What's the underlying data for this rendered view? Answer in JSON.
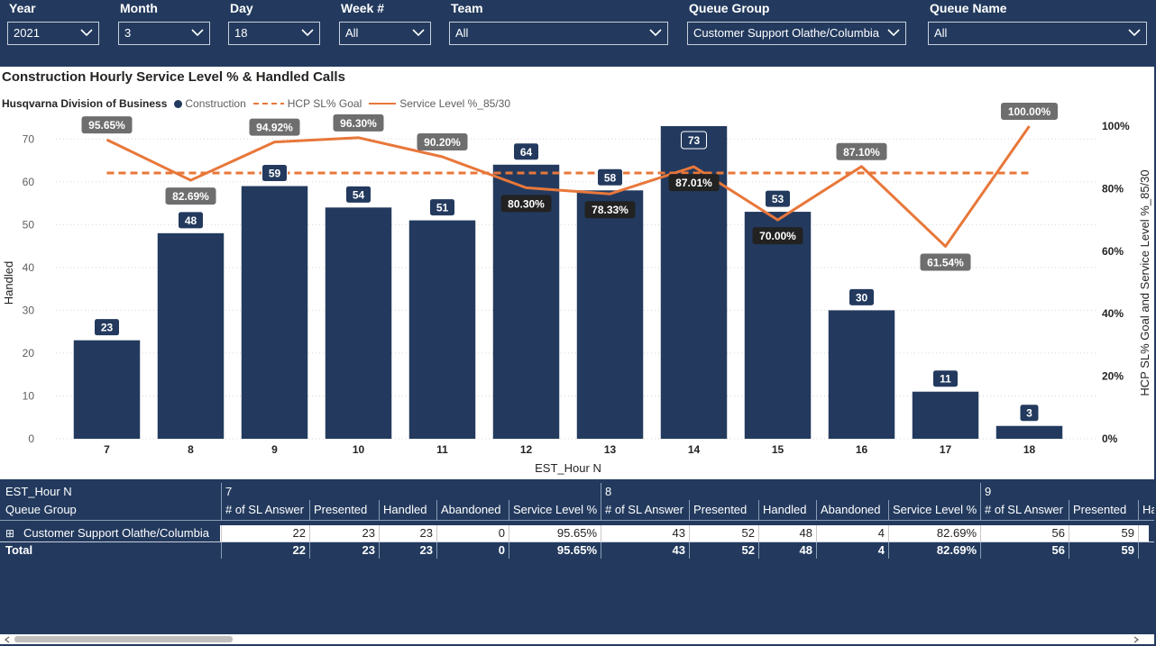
{
  "filters": [
    {
      "label": "Year",
      "value": "2021"
    },
    {
      "label": "Month",
      "value": "3"
    },
    {
      "label": "Day",
      "value": "18"
    },
    {
      "label": "Week #",
      "value": "All"
    },
    {
      "label": "Team",
      "value": "All"
    },
    {
      "label": "Queue Group",
      "value": "Customer Support Olathe/Columbia"
    },
    {
      "label": "Queue Name",
      "value": "All"
    }
  ],
  "colors": {
    "bar": "#233a5e",
    "line": "#e8773a",
    "goal": "#e8773a",
    "label_bg": "#233a5e",
    "pct_bg": "#6e6e6e",
    "pct_dark": "#222222"
  },
  "chart_data": {
    "type": "bar",
    "title": "Construction Hourly Service Level % & Handled Calls",
    "legend_title": "Husqvarna Division of Business",
    "xlabel": "EST_Hour N",
    "ylabel": "Handled",
    "y2label": "HCP SL% Goal and Service Level %_85/30",
    "ylim": [
      0,
      73
    ],
    "y2lim": [
      0,
      100
    ],
    "yticks": [
      "0",
      "10",
      "20",
      "30",
      "40",
      "50",
      "60",
      "70"
    ],
    "y2ticks": [
      "0%",
      "20%",
      "40%",
      "60%",
      "80%",
      "100%"
    ],
    "categories": [
      "7",
      "8",
      "9",
      "10",
      "11",
      "12",
      "13",
      "14",
      "15",
      "16",
      "17",
      "18"
    ],
    "series": [
      {
        "name": "Construction",
        "type": "bar",
        "values": [
          23,
          48,
          59,
          54,
          51,
          64,
          58,
          73,
          53,
          30,
          11,
          3
        ],
        "labels": [
          "23",
          "48",
          "59",
          "54",
          "51",
          "64",
          "58",
          "73",
          "53",
          "30",
          "11",
          "3"
        ]
      },
      {
        "name": "HCP SL% Goal",
        "type": "line",
        "dashed": true,
        "values": [
          85,
          85,
          85,
          85,
          85,
          85,
          85,
          85,
          85,
          85,
          85,
          85
        ]
      },
      {
        "name": "Service Level %_85/30",
        "type": "line",
        "values": [
          95.65,
          82.69,
          94.92,
          96.3,
          90.2,
          80.3,
          78.33,
          87.01,
          70.0,
          87.1,
          61.54,
          100.0
        ],
        "labels": [
          "95.65%",
          "82.69%",
          "94.92%",
          "96.30%",
          "90.20%",
          "80.30%",
          "78.33%",
          "87.01%",
          "70.00%",
          "87.10%",
          "61.54%",
          "100.00%"
        ]
      }
    ]
  },
  "matrix": {
    "corner1": "EST_Hour N",
    "corner2": "Queue Group",
    "hours": [
      "7",
      "8",
      "9"
    ],
    "columns": [
      "# of SL Answer",
      "Presented",
      "Handled",
      "Abandoned",
      "Service Level %",
      "# of SL Answer",
      "Presented",
      "Handled",
      "Abandoned",
      "Service Level %",
      "# of SL Answer",
      "Presented",
      "Han"
    ],
    "expand": "⊞",
    "row_label": "Customer Support Olathe/Columbia",
    "row": [
      "22",
      "23",
      "23",
      "0",
      "95.65%",
      "43",
      "52",
      "48",
      "4",
      "82.69%",
      "56",
      "59",
      ""
    ],
    "total_label": "Total",
    "total": [
      "22",
      "23",
      "23",
      "0",
      "95.65%",
      "43",
      "52",
      "48",
      "4",
      "82.69%",
      "56",
      "59",
      ""
    ]
  }
}
